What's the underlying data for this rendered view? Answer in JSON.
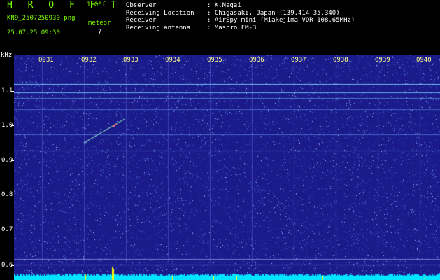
{
  "header": {
    "brand": "H R O F F T",
    "version": "1.00f",
    "filename": "KN9_2507250930.png",
    "meteor_label": "meteor",
    "meteor_count": "7",
    "datetime": "25.07.25 09:30"
  },
  "info": [
    {
      "label": "Observer",
      "value": ": K.Nagai"
    },
    {
      "label": "Receiving Location",
      "value": ": Chigasaki, Japan (139.414 35.340)"
    },
    {
      "label": "Receiver",
      "value": ": AirSpy mini (Miakejima VOR 108.65MHz)"
    },
    {
      "label": "Receiving antenna",
      "value": ": Maspro FM-3"
    }
  ],
  "axes": {
    "y_unit": "kHz",
    "y_labels": [
      "1.1",
      "1.0",
      "0.9",
      "0.8",
      "0.7",
      "0.6"
    ],
    "x_labels": [
      "0931",
      "0932",
      "0933",
      "0934",
      "0935",
      "0936",
      "0937",
      "0938",
      "0939",
      "0940"
    ]
  },
  "colors": {
    "background": "#1a1a8a",
    "noise_light": "#4a6ad8",
    "line_cyan": "#7ad4ff",
    "baseline": "#00e5ff",
    "peak": "#ffff00",
    "label_green": "#7CFC00"
  }
}
